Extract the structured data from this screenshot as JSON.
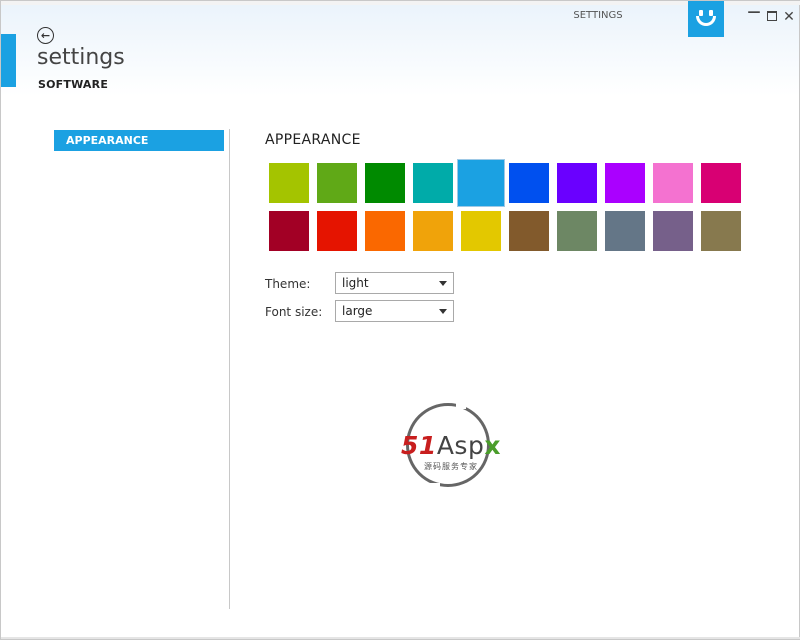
{
  "window": {
    "title": "SETTINGS",
    "controls": {
      "minimize": "—",
      "close": "✕"
    },
    "logo_icon": "smiley-icon"
  },
  "header": {
    "back_icon": "←",
    "title": "settings",
    "subtitle": "SOFTWARE"
  },
  "sidebar": {
    "items": [
      {
        "label": "APPEARANCE",
        "selected": true
      }
    ]
  },
  "main": {
    "section_title": "APPEARANCE",
    "swatches_row1": [
      "#a4c400",
      "#60a917",
      "#008a00",
      "#00aba9",
      "#1ba1e2",
      "#0050ef",
      "#6a00ff",
      "#aa00ff",
      "#f472d0",
      "#d80073"
    ],
    "swatches_row2": [
      "#a20025",
      "#e51400",
      "#fa6800",
      "#f0a30a",
      "#e3c800",
      "#825a2c",
      "#6d8764",
      "#647687",
      "#76608a",
      "#87794e"
    ],
    "selected_color": "#1ba1e2",
    "theme": {
      "label": "Theme:",
      "value": "light"
    },
    "font_size": {
      "label": "Font size:",
      "value": "large"
    }
  },
  "watermark": {
    "brand_number": "51",
    "brand_word": "Asp",
    "brand_x": "x",
    "tagline": "源码服务专家"
  }
}
